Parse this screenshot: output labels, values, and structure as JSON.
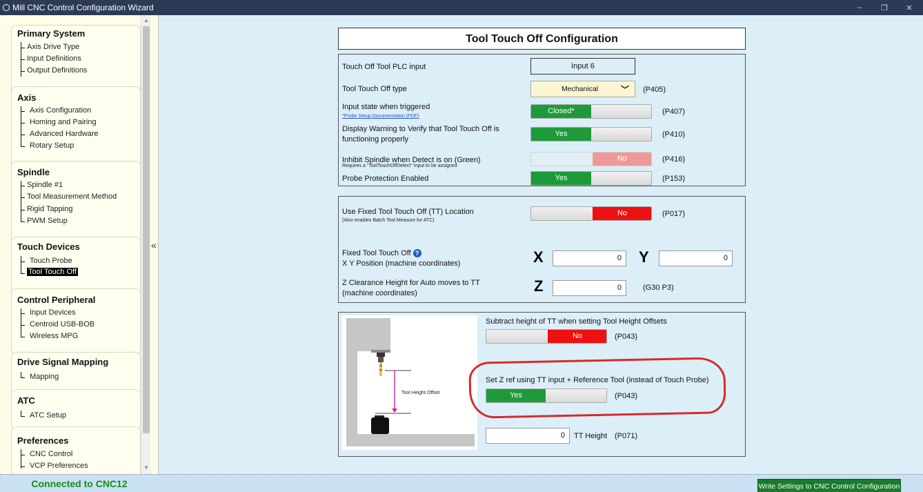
{
  "window": {
    "title": "Mill CNC Control Configuration Wizard",
    "minimize": "–",
    "restore": "❐",
    "close": "✕"
  },
  "sidebar": {
    "collapse_symbol": "«",
    "groups": [
      {
        "title": "Primary System",
        "items": [
          "Axis Drive Type",
          "Input Definitions",
          "Output Definitions"
        ]
      },
      {
        "title": "Axis",
        "items": [
          "Axis Configuration",
          "Homing and Pairing",
          "Advanced Hardware",
          "Rotary Setup"
        ]
      },
      {
        "title": "Spindle",
        "items": [
          "Spindle #1",
          "Tool Measurement Method",
          "Rigid Tapping",
          "PWM Setup"
        ]
      },
      {
        "title": "Touch Devices",
        "items": [
          "Touch Probe",
          "Tool Touch Off"
        ],
        "selected": "Tool Touch Off"
      },
      {
        "title": "Control Peripheral",
        "items": [
          "Input Devices",
          "Centroid USB-BOB",
          "Wireless MPG"
        ]
      },
      {
        "title": "Drive Signal Mapping",
        "items": [
          "Mapping"
        ]
      },
      {
        "title": "ATC",
        "items": [
          "ATC Setup"
        ]
      },
      {
        "title": "Preferences",
        "items": [
          "CNC Control",
          "VCP Preferences"
        ]
      }
    ]
  },
  "status": {
    "connection": "Connected to CNC12",
    "write_button": "Write Settings to CNC Control Configuration"
  },
  "main": {
    "heading": "Tool Touch Off Configuration",
    "section1": {
      "plc_input_label": "Touch Off Tool PLC input",
      "plc_input_value": "Input 6",
      "type_label": "Tool Touch Off type",
      "type_value": "Mechanical",
      "type_code": "(P405)",
      "state_label": "Input state when triggered",
      "state_link": "*Probe Setup Documentation (PDF)",
      "state_value": "Closed*",
      "state_code": "(P407)",
      "warning_label_1": "Display Warning to Verify that Tool Touch Off is",
      "warning_label_2": "functioning properly",
      "warning_value": "Yes",
      "warning_code": "(P410)",
      "inhibit_label": "Inhibit Spindle when Detect is on (Green)",
      "inhibit_sub": "Requires a \"ToolTouchOffDetect\" Input to be assigned",
      "inhibit_value": "No",
      "inhibit_code": "(P416)",
      "protection_label": "Probe Protection Enabled",
      "protection_value": "Yes",
      "protection_code": "(P153)"
    },
    "section2": {
      "fixed_label": "Use Fixed Tool Touch Off (TT) Location",
      "fixed_sub": "(Also enables Batch Tool Measure for ATC)",
      "fixed_value": "No",
      "fixed_code": "(P017)",
      "xy_label_1": "Fixed Tool Touch Off",
      "xy_label_2": "X Y Position (machine coordinates)",
      "x_axis": "X",
      "x_value": "0",
      "y_axis": "Y",
      "y_value": "0",
      "z_label_1": "Z Clearance Height for Auto moves to TT",
      "z_label_2": "(machine coordinates)",
      "z_axis": "Z",
      "z_value": "0",
      "z_code": "(G30 P3)"
    },
    "section3": {
      "diagram_label": "Tool Height Offset",
      "subtract_label": "Subtract height of TT when setting Tool Height Offsets",
      "subtract_value": "No",
      "subtract_code": "(P043)",
      "zref_label": "Set Z ref using TT input + Reference Tool (instead of Touch Probe)",
      "zref_value": "Yes",
      "zref_code": "(P043)",
      "tt_height_value": "0",
      "tt_height_label": "TT Height",
      "tt_height_code": "(P071)"
    }
  }
}
